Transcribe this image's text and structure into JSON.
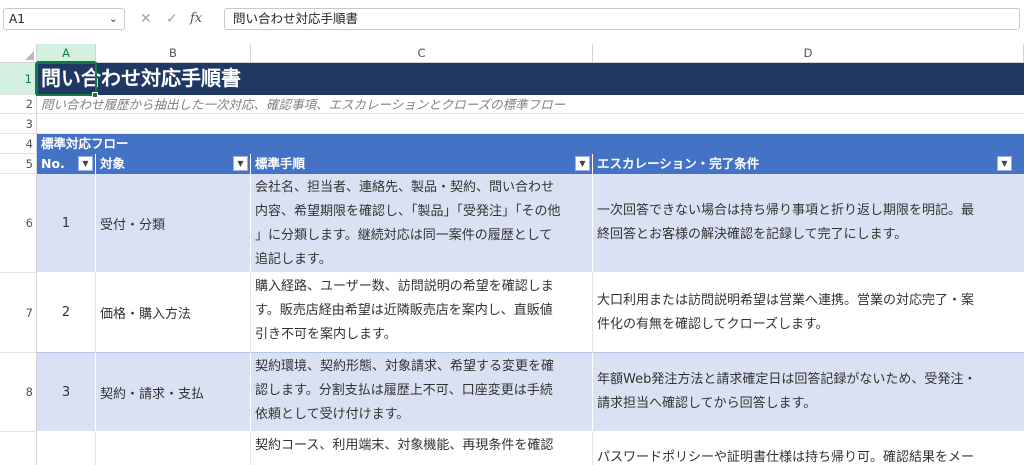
{
  "formula_bar": {
    "name_box": "A1",
    "cancel_icon": "✕",
    "enter_icon": "✓",
    "function_icon": "fx",
    "formula": "問い合わせ対応手順書"
  },
  "columns": [
    "A",
    "B",
    "C",
    "D"
  ],
  "selected_column": "A",
  "rows": [
    "1",
    "2",
    "3",
    "4",
    "5",
    "6",
    "7",
    "8",
    ""
  ],
  "sheet": {
    "title": "問い合わせ対応手順書",
    "subtitle": "問い合わせ履歴から抽出した一次対応、確認事項、エスカレーションとクローズの標準フロー",
    "section": "標準対応フロー",
    "headers": {
      "no": "No.",
      "target": "対象",
      "procedure": "標準手順",
      "escalation": "エスカレーション・完了条件"
    },
    "table": [
      {
        "no": "1",
        "target": "受付・分類",
        "procedure": [
          "会社名、担当者、連絡先、製品・契約、問い合わせ",
          "内容、希望期限を確認し、「製品」「受発注」「その他",
          "」に分類します。継続対応は同一案件の履歴として",
          "追記します。"
        ],
        "escalation": [
          "一次回答できない場合は持ち帰り事項と折り返し期限を明記。最",
          "終回答とお客様の解決確認を記録して完了にします。"
        ]
      },
      {
        "no": "2",
        "target": "価格・購入方法",
        "procedure": [
          "購入経路、ユーザー数、訪問説明の希望を確認しま",
          "す。販売店経由希望は近隣販売店を案内し、直販値",
          "引き不可を案内します。"
        ],
        "escalation": [
          "大口利用または訪問説明希望は営業へ連携。営業の対応完了・案",
          "件化の有無を確認してクローズします。"
        ]
      },
      {
        "no": "3",
        "target": "契約・請求・支払",
        "procedure": [
          "契約環境、契約形態、対象請求、希望する変更を確",
          "認します。分割支払は履歴上不可、口座変更は手続",
          "依頼として受け付けます。"
        ],
        "escalation": [
          "年額Web発注方法と請求確定日は回答記録がないため、受発注・",
          "請求担当へ確認してから回答します。"
        ]
      },
      {
        "no": "",
        "target": "",
        "procedure": [
          "契約コース、利用端末、対象機能、再現条件を確認"
        ],
        "escalation": [
          "パスワードポリシーや証明書仕様は持ち帰り可。確認結果をメー"
        ]
      }
    ]
  }
}
